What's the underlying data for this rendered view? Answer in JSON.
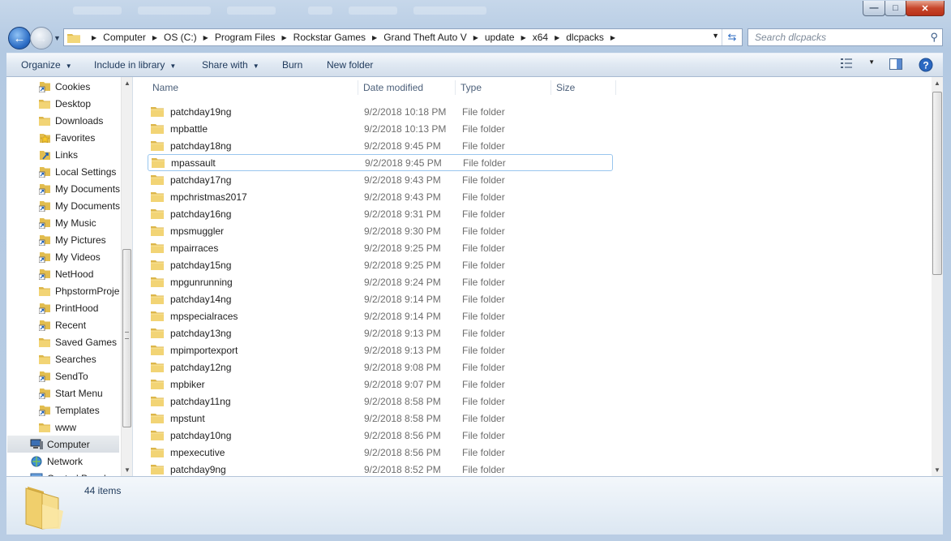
{
  "window": {
    "minimize": "—",
    "maximize": "□",
    "close": "✕"
  },
  "address": {
    "crumbs": [
      "Computer",
      "OS (C:)",
      "Program Files",
      "Rockstar Games",
      "Grand Theft Auto V",
      "update",
      "x64",
      "dlcpacks"
    ],
    "search_placeholder": "Search dlcpacks"
  },
  "toolbar": {
    "organize": "Organize",
    "include_in_library": "Include in library",
    "share_with": "Share with",
    "burn": "Burn",
    "new_folder": "New folder"
  },
  "nav": {
    "items": [
      "Cookies",
      "Desktop",
      "Downloads",
      "Favorites",
      "Links",
      "Local Settings",
      "My Documents",
      "My Documents",
      "My Music",
      "My Pictures",
      "My Videos",
      "NetHood",
      "PhpstormProje",
      "PrintHood",
      "Recent",
      "Saved Games",
      "Searches",
      "SendTo",
      "Start Menu",
      "Templates",
      "www"
    ],
    "computer": "Computer",
    "network": "Network",
    "control_panel": "Control Panel"
  },
  "columns": {
    "name": "Name",
    "date": "Date modified",
    "type": "Type",
    "size": "Size"
  },
  "files": [
    {
      "name": "patchday19ng",
      "date": "9/2/2018 10:18 PM",
      "type": "File folder"
    },
    {
      "name": "mpbattle",
      "date": "9/2/2018 10:13 PM",
      "type": "File folder"
    },
    {
      "name": "patchday18ng",
      "date": "9/2/2018 9:45 PM",
      "type": "File folder"
    },
    {
      "name": "mpassault",
      "date": "9/2/2018 9:45 PM",
      "type": "File folder"
    },
    {
      "name": "patchday17ng",
      "date": "9/2/2018 9:43 PM",
      "type": "File folder"
    },
    {
      "name": "mpchristmas2017",
      "date": "9/2/2018 9:43 PM",
      "type": "File folder"
    },
    {
      "name": "patchday16ng",
      "date": "9/2/2018 9:31 PM",
      "type": "File folder"
    },
    {
      "name": "mpsmuggler",
      "date": "9/2/2018 9:30 PM",
      "type": "File folder"
    },
    {
      "name": "mpairraces",
      "date": "9/2/2018 9:25 PM",
      "type": "File folder"
    },
    {
      "name": "patchday15ng",
      "date": "9/2/2018 9:25 PM",
      "type": "File folder"
    },
    {
      "name": "mpgunrunning",
      "date": "9/2/2018 9:24 PM",
      "type": "File folder"
    },
    {
      "name": "patchday14ng",
      "date": "9/2/2018 9:14 PM",
      "type": "File folder"
    },
    {
      "name": "mpspecialraces",
      "date": "9/2/2018 9:14 PM",
      "type": "File folder"
    },
    {
      "name": "patchday13ng",
      "date": "9/2/2018 9:13 PM",
      "type": "File folder"
    },
    {
      "name": "mpimportexport",
      "date": "9/2/2018 9:13 PM",
      "type": "File folder"
    },
    {
      "name": "patchday12ng",
      "date": "9/2/2018 9:08 PM",
      "type": "File folder"
    },
    {
      "name": "mpbiker",
      "date": "9/2/2018 9:07 PM",
      "type": "File folder"
    },
    {
      "name": "patchday11ng",
      "date": "9/2/2018 8:58 PM",
      "type": "File folder"
    },
    {
      "name": "mpstunt",
      "date": "9/2/2018 8:58 PM",
      "type": "File folder"
    },
    {
      "name": "patchday10ng",
      "date": "9/2/2018 8:56 PM",
      "type": "File folder"
    },
    {
      "name": "mpexecutive",
      "date": "9/2/2018 8:56 PM",
      "type": "File folder"
    },
    {
      "name": "patchday9ng",
      "date": "9/2/2018 8:52 PM",
      "type": "File folder"
    }
  ],
  "selected_file": "mpassault",
  "status": {
    "count": "44 items"
  },
  "colors": {
    "accent": "#2b6cc4",
    "selection_border": "#99c6ee",
    "folder": "#e8c55a"
  }
}
